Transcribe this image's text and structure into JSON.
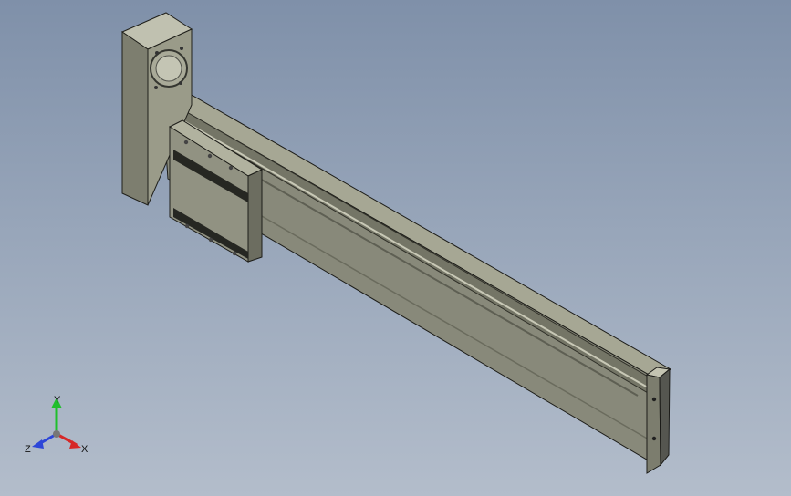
{
  "viewport": {
    "background_top": "#7f90a9",
    "background_bottom": "#b3bdcb"
  },
  "model": {
    "body_color": "#8b8c7a",
    "dark_color": "#2f302b",
    "light_color": "#b7b8a6"
  },
  "triad": {
    "x_label": "X",
    "y_label": "Y",
    "z_label": "Z",
    "x_color": "#d62828",
    "y_color": "#1fbf2c",
    "z_color": "#2d46d8"
  }
}
